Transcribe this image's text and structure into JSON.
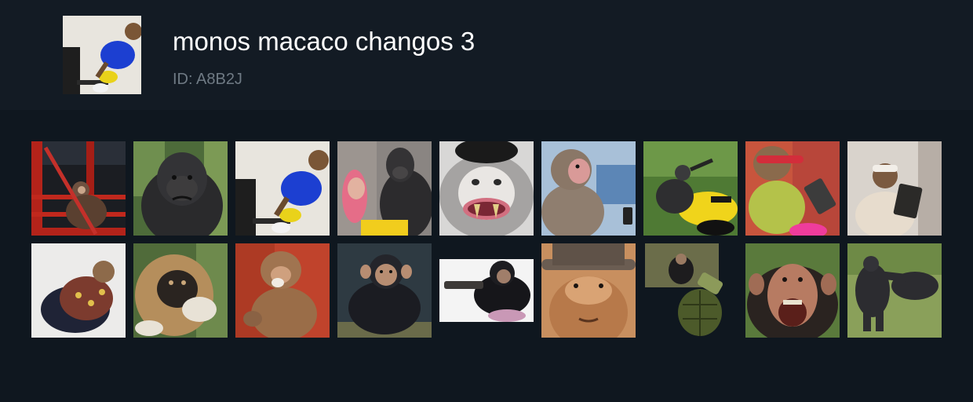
{
  "pack": {
    "title": "monos macaco changos 3",
    "id_text": "ID: A8B2J",
    "cover_icon": "monkey-blue-shirt-icon"
  },
  "stickers": [
    {
      "name": "sticker-monkey-red-building",
      "icon": "monkey-icon"
    },
    {
      "name": "sticker-gorilla-frowning",
      "icon": "gorilla-icon"
    },
    {
      "name": "sticker-monkey-blue-shirt",
      "icon": "monkey-icon"
    },
    {
      "name": "sticker-gorilla-and-woman",
      "icon": "gorilla-icon"
    },
    {
      "name": "sticker-snub-nosed-monkey-fangs",
      "icon": "monkey-icon"
    },
    {
      "name": "sticker-macaque-with-phone",
      "icon": "monkey-icon"
    },
    {
      "name": "sticker-monkey-on-motorbike",
      "icon": "monkey-icon"
    },
    {
      "name": "sticker-monkey-with-sunglasses",
      "icon": "monkey-icon"
    },
    {
      "name": "sticker-monkey-reading-tablet",
      "icon": "monkey-icon"
    },
    {
      "name": "sticker-baby-monkey-blanket",
      "icon": "monkey-icon"
    },
    {
      "name": "sticker-gibbon-thinking",
      "icon": "gibbon-icon"
    },
    {
      "name": "sticker-monkey-eating",
      "icon": "monkey-icon"
    },
    {
      "name": "sticker-chimpanzee-sitting",
      "icon": "chimpanzee-icon"
    },
    {
      "name": "sticker-chimpanzee-with-gun",
      "icon": "chimpanzee-icon"
    },
    {
      "name": "sticker-monkey-with-hat",
      "icon": "monkey-icon"
    },
    {
      "name": "sticker-chimp-and-grenade",
      "icon": "grenade-icon"
    },
    {
      "name": "sticker-chimpanzee-screaming",
      "icon": "chimpanzee-icon"
    },
    {
      "name": "sticker-gorillas-fighting",
      "icon": "gorilla-icon"
    }
  ]
}
